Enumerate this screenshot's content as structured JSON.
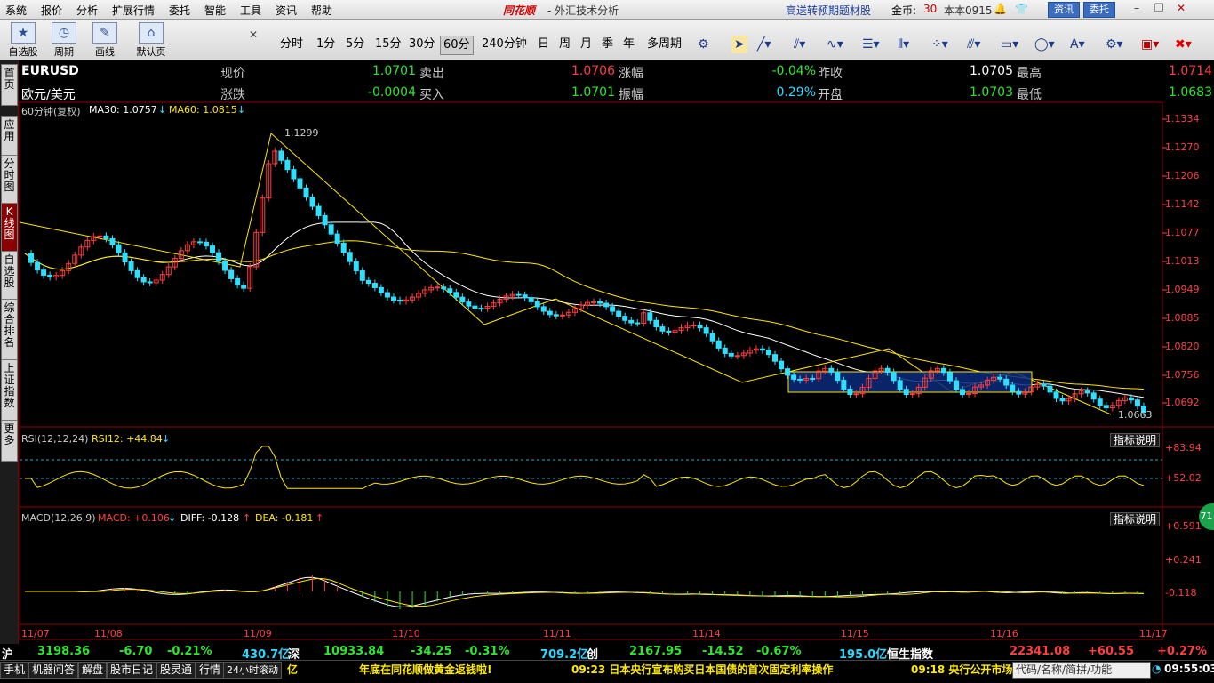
{
  "menubar": {
    "items": [
      "系统",
      "报价",
      "分析",
      "扩展行情",
      "委托",
      "智能",
      "工具",
      "资讯",
      "帮助"
    ],
    "app_title": "同花顺",
    "subtitle": "- 外汇技术分析",
    "promo": "高送转预期题材股",
    "gold_label": "金币:",
    "gold_value": "30",
    "version": "本本0915",
    "btn_news": "资讯",
    "btn_trade": "委托"
  },
  "toolbar": {
    "big_buttons": [
      "自选股",
      "周期",
      "画线",
      "默认页"
    ],
    "periods": [
      "分时",
      "1分",
      "5分",
      "15分",
      "30分",
      "60分",
      "240分钟",
      "日",
      "周",
      "月",
      "季",
      "年",
      "多周期"
    ],
    "active_period": "60分"
  },
  "left_tabs": [
    "首页",
    "应用",
    "分时图",
    "K线图",
    "自选股",
    "综合排名",
    "上证指数",
    "更多"
  ],
  "quote": {
    "symbol": "EURUSD",
    "name": "欧元/美元",
    "rows": [
      [
        {
          "l": "现价",
          "v": "1.0701",
          "c": "green"
        },
        {
          "l": "卖出",
          "v": "1.0706",
          "c": "red"
        },
        {
          "l": "涨幅",
          "v": "-0.04%",
          "c": "green"
        },
        {
          "l": "昨收",
          "v": "1.0705",
          "c": "white"
        },
        {
          "l": "最高",
          "v": "1.0714",
          "c": "red"
        }
      ],
      [
        {
          "l": "涨跌",
          "v": "-0.0004",
          "c": "green"
        },
        {
          "l": "买入",
          "v": "1.0701",
          "c": "green"
        },
        {
          "l": "振幅",
          "v": "0.29%",
          "c": "cyan"
        },
        {
          "l": "开盘",
          "v": "1.0703",
          "c": "green"
        },
        {
          "l": "最低",
          "v": "1.0683",
          "c": "green"
        }
      ]
    ]
  },
  "main_panel": {
    "period_label": "60分钟(复权)",
    "ma30": "MA30: 1.0757",
    "ma60": "MA60: 1.0815",
    "y_ticks": [
      "1.1334",
      "1.1270",
      "1.1206",
      "1.1142",
      "1.1077",
      "1.1013",
      "1.0949",
      "1.0885",
      "1.0820",
      "1.0756",
      "1.0692"
    ],
    "high_note": "1.1299",
    "low_note": "1.0663"
  },
  "rsi_panel": {
    "label": "RSI(12,12,24)",
    "rsi12": "RSI12: +44.84",
    "btn": "指标说明",
    "y_ticks": [
      "+83.94",
      "+52.02"
    ]
  },
  "macd_panel": {
    "label": "MACD(12,26,9)",
    "macd": "MACD: +0.106",
    "diff": "DIFF: -0.128",
    "dea": "DEA: -0.181",
    "btn": "指标说明",
    "y_ticks": [
      "+0.591",
      "+0.241",
      "-0.118"
    ],
    "badge": "71"
  },
  "x_dates": [
    "11/07",
    "11/08",
    "11/09",
    "11/10",
    "11/11",
    "11/14",
    "11/15",
    "11/16",
    "11/17"
  ],
  "ticker": {
    "sh_label": "沪",
    "sh_val": "3198.36",
    "sh_chg": "-6.70",
    "sh_pct": "-0.21%",
    "sh_amt": "430.7亿",
    "sz_label": "深",
    "sz_val": "10933.84",
    "sz_chg": "-34.25",
    "sz_pct": "-0.31%",
    "sz_amt": "709.2亿",
    "cy_label": "创",
    "cy_val": "2167.95",
    "cy_chg": "-14.52",
    "cy_pct": "-0.67%",
    "cy_amt": "195.0亿",
    "hs_label": "恒生指数",
    "hs_val": "22341.08",
    "hs_chg": "+60.55",
    "hs_pct": "+0.27%"
  },
  "statusbar": {
    "buttons": [
      "手机",
      "机器问答",
      "解盘",
      "股市日记",
      "股灵通",
      "行情",
      "24小时滚动"
    ],
    "amt_tail": "亿",
    "news1": "年底在同花顺做黄金返钱啦!",
    "news2": "09:23 日本央行宣布购买日本国债的首次固定利率操作",
    "news3": "09:18 央行公开市场",
    "search": "代码/名称/简拼/功能",
    "clock": "09:55:03"
  },
  "colors": {
    "up": "#ff3d3d",
    "down": "#2ee0ff",
    "ma30": "#ffffff",
    "ma60": "#ffe600",
    "grid": "#8b0000"
  }
}
